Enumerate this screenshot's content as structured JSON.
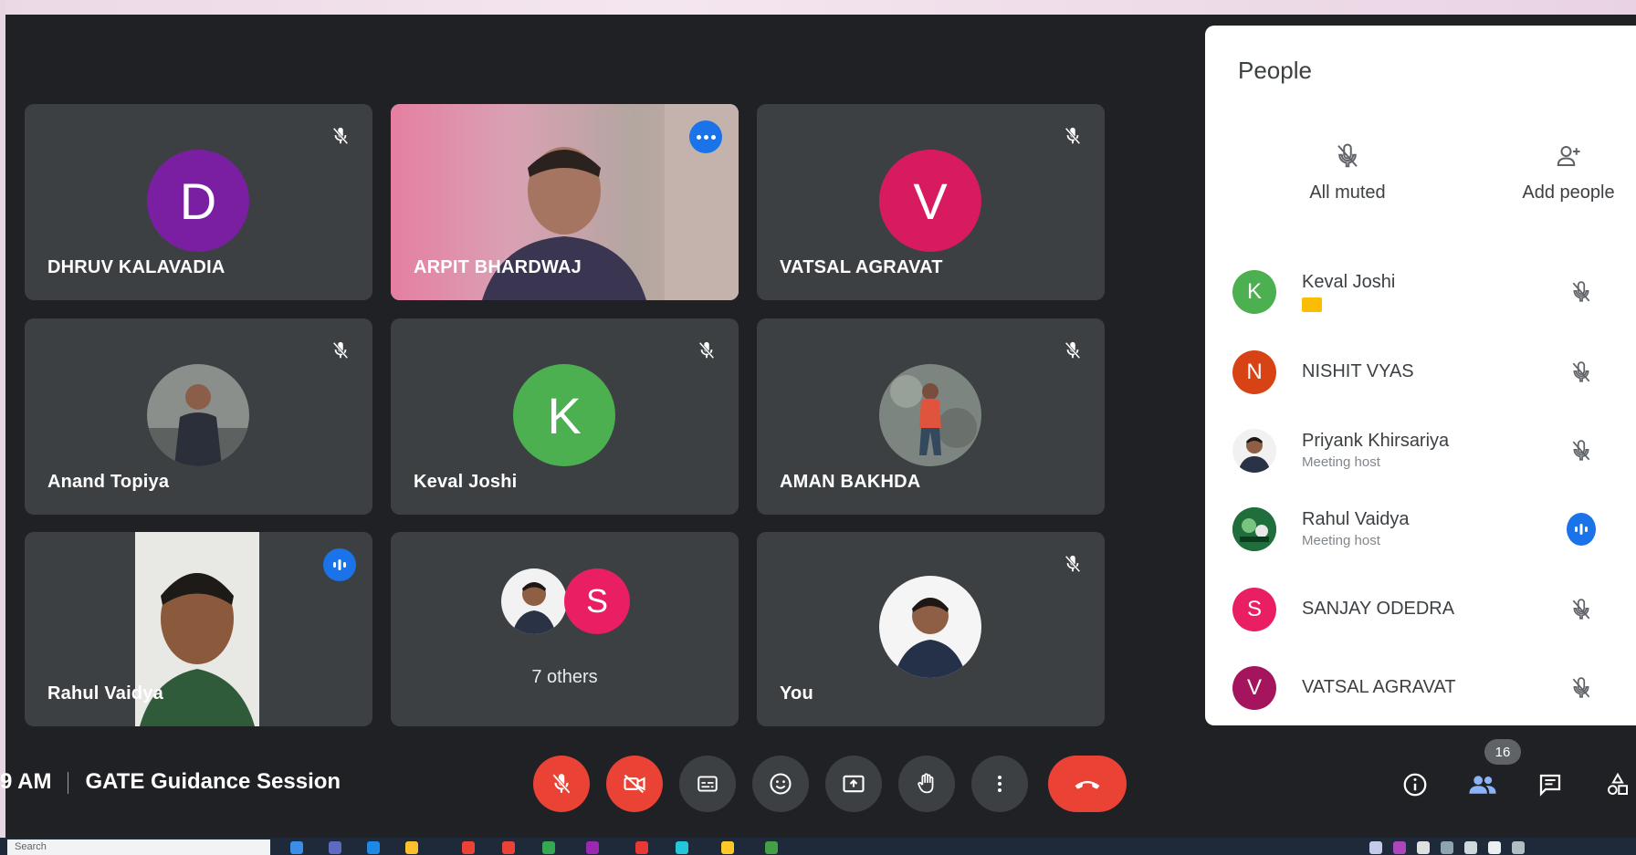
{
  "meeting": {
    "time_fragment": "9 AM",
    "title": "GATE Guidance Session"
  },
  "colors": {
    "background": "#202124",
    "tile": "#3c4043",
    "accent_blue": "#1a73e8",
    "end_call_red": "#ea4335",
    "avatar_purple": "#7b1fa2",
    "avatar_pink": "#d81b60",
    "avatar_green": "#4caf50",
    "avatar_orange_red": "#d84315",
    "avatar_pink_light": "#e91e63",
    "avatar_maroon": "#a4155e"
  },
  "tiles": [
    {
      "name": "DHRUV KALAVADIA",
      "avatar_letter": "D",
      "muted": true
    },
    {
      "name": "ARPIT BHARDWAJ",
      "avatar": "video",
      "more_options": true
    },
    {
      "name": "VATSAL AGRAVAT",
      "avatar_letter": "V",
      "muted": true
    },
    {
      "name": "Anand Topiya",
      "avatar": "photo",
      "muted": true
    },
    {
      "name": "Keval Joshi",
      "avatar_letter": "K",
      "muted": true
    },
    {
      "name": "AMAN BAKHDA",
      "avatar": "photo",
      "muted": true
    },
    {
      "name": "Rahul Vaidya",
      "avatar": "video",
      "speaking": true
    },
    {
      "name": "7 others",
      "avatar_letter": "S",
      "group": true
    },
    {
      "name": "You",
      "avatar": "photo",
      "muted": true
    }
  ],
  "people_panel": {
    "title": "People",
    "all_muted_label": "All muted",
    "add_people_label": "Add people",
    "participants": [
      {
        "name": "Keval Joshi",
        "letter": "K",
        "subtitle": "",
        "status": "muted-icon"
      },
      {
        "name": "NISHIT VYAS",
        "letter": "N",
        "subtitle": "",
        "status": "muted-icon"
      },
      {
        "name": "Priyank Khirsariya",
        "letter": "",
        "subtitle": "Meeting host",
        "status": "muted-icon"
      },
      {
        "name": "Rahul Vaidya",
        "letter": "",
        "subtitle": "Meeting host",
        "status": "speaking-icon"
      },
      {
        "name": "SANJAY ODEDRA",
        "letter": "S",
        "subtitle": "",
        "status": "muted-icon"
      },
      {
        "name": "VATSAL AGRAVAT",
        "letter": "V",
        "subtitle": "",
        "status": "muted-icon"
      }
    ]
  },
  "controls": [
    "mic-off-icon",
    "camera-off-icon",
    "captions-icon",
    "emoji-icon",
    "present-icon",
    "raise-hand-icon",
    "more-vert-icon",
    "end-call-icon"
  ],
  "right_controls": {
    "participant_count": "16",
    "icons": [
      "info-icon",
      "people-icon",
      "chat-icon",
      "activities-icon"
    ]
  },
  "taskbar": {
    "search_placeholder": "Search"
  }
}
